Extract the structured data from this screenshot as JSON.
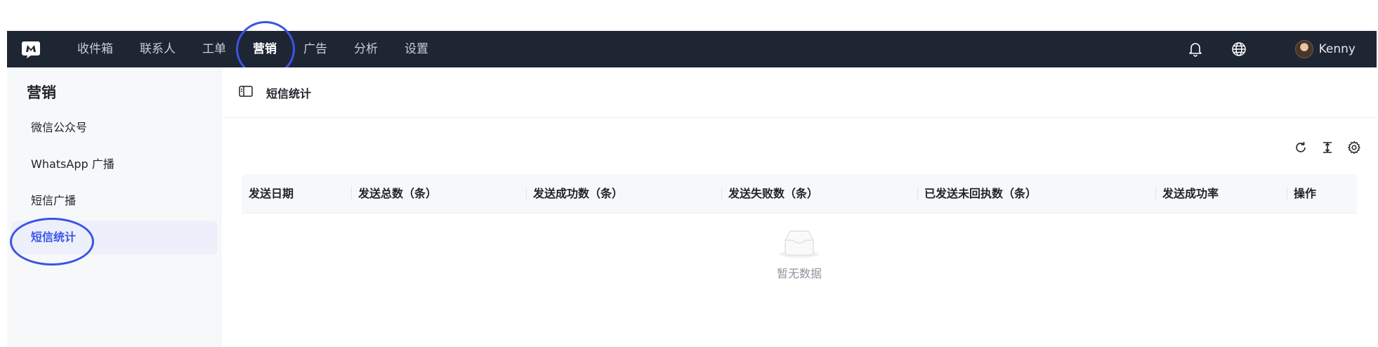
{
  "topbar": {
    "logo_icon": "brand-logo-icon",
    "nav": [
      {
        "label": "收件箱"
      },
      {
        "label": "联系人"
      },
      {
        "label": "工单"
      },
      {
        "label": "营销"
      },
      {
        "label": "广告"
      },
      {
        "label": "分析"
      },
      {
        "label": "设置"
      }
    ],
    "active_nav": "营销",
    "notification_icon": "bell-icon",
    "language_icon": "globe-icon",
    "user_name": "Kenny"
  },
  "sidebar": {
    "title": "营销",
    "items": [
      {
        "label": "微信公众号"
      },
      {
        "label": "WhatsApp 广播"
      },
      {
        "label": "短信广播"
      },
      {
        "label": "短信统计"
      }
    ],
    "active_item": "短信统计"
  },
  "main": {
    "title": "短信统计",
    "toolbar_icons": [
      "refresh-icon",
      "column-height-icon",
      "settings-icon"
    ],
    "columns": [
      {
        "label": "发送日期"
      },
      {
        "label": "发送总数（条）"
      },
      {
        "label": "发送成功数（条）"
      },
      {
        "label": "发送失败数（条）"
      },
      {
        "label": "已发送未回执数（条）"
      },
      {
        "label": "发送成功率"
      },
      {
        "label": "操作"
      }
    ],
    "empty_text": "暂无数据"
  },
  "colors": {
    "topbar_bg": "#1e2533",
    "accent": "#3b54e6",
    "sidebar_bg": "#f7f8fa",
    "active_item_bg": "#edf0fb"
  }
}
